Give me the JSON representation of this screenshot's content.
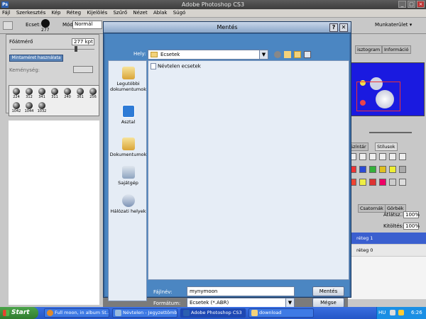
{
  "app": {
    "title": "Adobe Photoshop CS3",
    "logo_text": "Ps"
  },
  "menu": [
    "Fájl",
    "Szerkesztés",
    "Kép",
    "Réteg",
    "Kijelölés",
    "Szűrő",
    "Nézet",
    "Ablak",
    "Súgó"
  ],
  "options_bar": {
    "brush_label": "Ecset:",
    "brush_size": "277",
    "mode_label": "Mód:",
    "mode_value": "Normál",
    "workspace_label": "Munkaterület ▾"
  },
  "brush_panel": {
    "diameter_label": "Főátmérő",
    "diameter_value": "277 kpt",
    "sample_button": "Mintaméret használata",
    "hardness_label": "Keménység:",
    "brushes": [
      "224",
      "312",
      "341",
      "311",
      "240",
      "361",
      "256",
      "1042",
      "1044",
      "1032"
    ]
  },
  "right_panels": {
    "navigator_tabs": [
      "isztogram",
      "Információ"
    ],
    "swatch_tabs": [
      "Színtár",
      "Stílusok"
    ],
    "layer_tabs": [
      "Csatornák",
      "Görbék"
    ],
    "opacity_label": "Átlátsz.:",
    "opacity_value": "100%",
    "fill_label": "Kitöltés:",
    "fill_value": "100%",
    "layers": [
      "réteg 1",
      "réteg 0"
    ]
  },
  "dialog": {
    "title": "Mentés",
    "help_button": "?",
    "close_button": "✕",
    "lookin_label": "Hely:",
    "lookin_value": "Ecsetek",
    "places": [
      "Legutóbbi dokumentumok",
      "Asztal",
      "Dokumentumok",
      "Sajátgép",
      "Hálózati helyek"
    ],
    "files": [
      "Névtelen ecsetek"
    ],
    "filename_label": "Fájlnév:",
    "filename_value": "mynymoon",
    "format_label": "Formátum:",
    "format_value": "Ecsetek (*.ABR)",
    "save_button": "Mentés",
    "cancel_button": "Mégse"
  },
  "taskbar": {
    "start": "Start",
    "tasks": [
      "Full moon, in album St...",
      "Névtelen - Jegyzettömb",
      "Adobe Photoshop CS3",
      "download"
    ],
    "lang": "HU",
    "clock": "6:26"
  }
}
